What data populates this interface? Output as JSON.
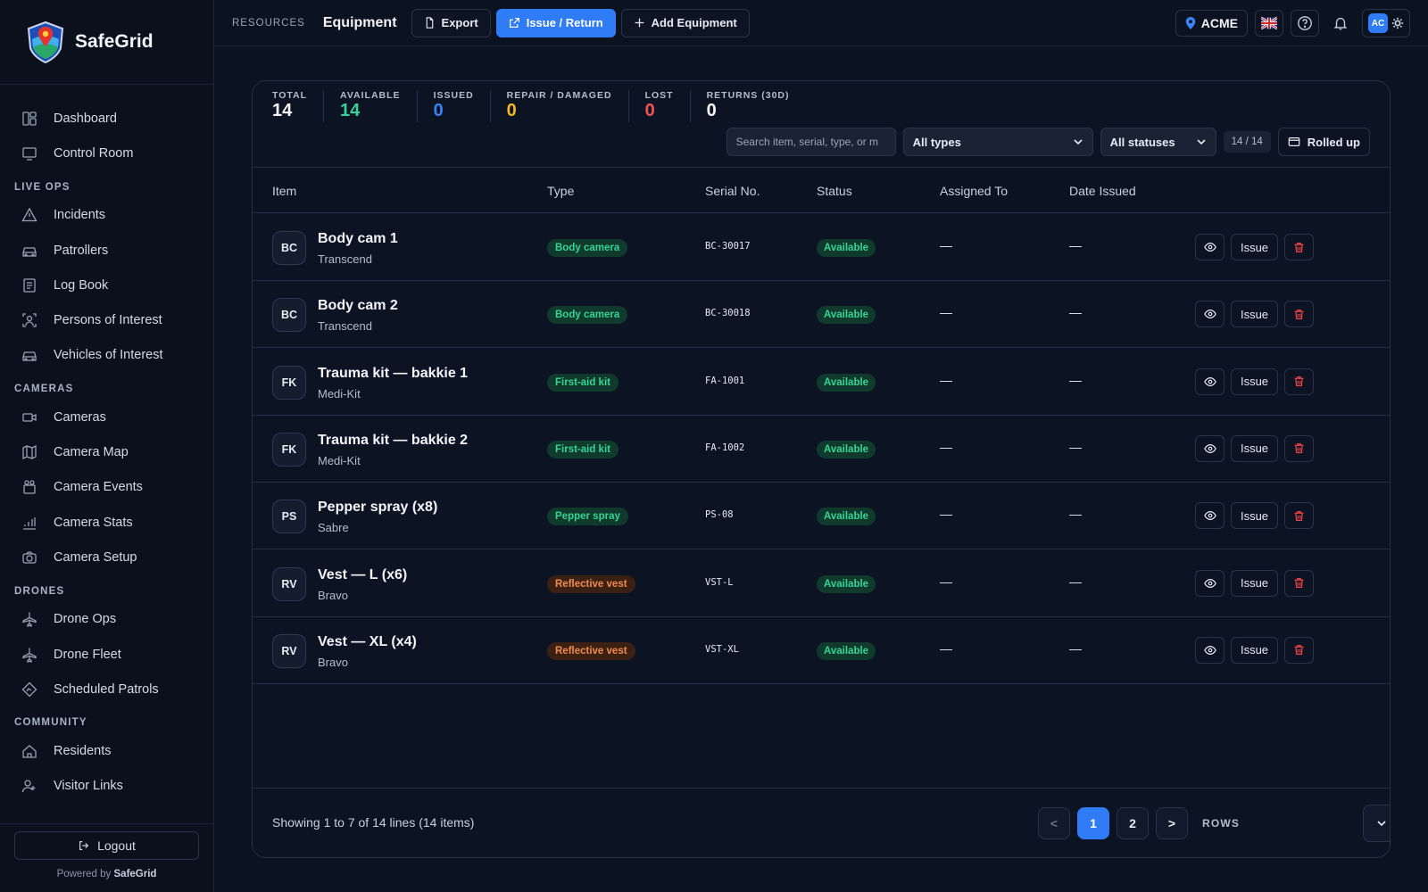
{
  "brand": {
    "name": "SafeGrid"
  },
  "nav": {
    "items_top": [
      {
        "label": "Dashboard",
        "icon": "dashboard-icon"
      },
      {
        "label": "Control Room",
        "icon": "monitor-icon"
      }
    ],
    "live_ops": {
      "title": "LIVE OPS",
      "items": [
        {
          "label": "Incidents",
          "icon": "warning-icon"
        },
        {
          "label": "Patrollers",
          "icon": "car-icon"
        },
        {
          "label": "Log Book",
          "icon": "logbook-icon"
        },
        {
          "label": "Persons of Interest",
          "icon": "person-scan-icon"
        },
        {
          "label": "Vehicles of Interest",
          "icon": "car-icon"
        }
      ]
    },
    "cameras": {
      "title": "CAMERAS",
      "items": [
        {
          "label": "Cameras",
          "icon": "camera-icon"
        },
        {
          "label": "Camera Map",
          "icon": "map-icon"
        },
        {
          "label": "Camera Events",
          "icon": "film-icon"
        },
        {
          "label": "Camera Stats",
          "icon": "bar-chart-icon"
        },
        {
          "label": "Camera Setup",
          "icon": "camera-setup-icon"
        }
      ]
    },
    "drones": {
      "title": "DRONES",
      "items": [
        {
          "label": "Drone Ops",
          "icon": "plane-icon"
        },
        {
          "label": "Drone Fleet",
          "icon": "plane-icon"
        },
        {
          "label": "Scheduled Patrols",
          "icon": "route-icon"
        }
      ]
    },
    "community": {
      "title": "COMMUNITY",
      "items": [
        {
          "label": "Residents",
          "icon": "home-icon"
        },
        {
          "label": "Visitor Links",
          "icon": "user-plus-icon"
        }
      ]
    },
    "logout": "Logout",
    "powered_prefix": "Powered by",
    "powered_brand": "SafeGrid"
  },
  "topbar": {
    "crumb": "RESOURCES",
    "title": "Equipment",
    "export": "Export",
    "issue_return": "Issue / Return",
    "add_equipment": "Add Equipment",
    "org": "ACME",
    "avatar": "AC"
  },
  "stats": [
    {
      "label": "TOTAL",
      "value": "14",
      "color": "#f2f5fa"
    },
    {
      "label": "AVAILABLE",
      "value": "14",
      "color": "#34d399"
    },
    {
      "label": "ISSUED",
      "value": "0",
      "color": "#3b82f6"
    },
    {
      "label": "REPAIR / DAMAGED",
      "value": "0",
      "color": "#f5b626"
    },
    {
      "label": "LOST",
      "value": "0",
      "color": "#f05252"
    },
    {
      "label": "RETURNS (30D)",
      "value": "0",
      "color": "#f2f5fa"
    }
  ],
  "filters": {
    "search_placeholder": "Search item, serial, type, or m",
    "type_select": "All types",
    "status_select": "All statuses",
    "count": "14 / 14",
    "rolled_up": "Rolled up"
  },
  "table": {
    "headers": [
      "Item",
      "Type",
      "Serial No.",
      "Status",
      "Assigned To",
      "Date Issued"
    ],
    "issue_label": "Issue",
    "rows": [
      {
        "abbr": "BC",
        "name": "Body cam 1",
        "brand": "Transcend",
        "type": "Body camera",
        "type_style": "green",
        "serial": "BC-30017",
        "status": "Available",
        "assigned": "—",
        "date": "—"
      },
      {
        "abbr": "BC",
        "name": "Body cam 2",
        "brand": "Transcend",
        "type": "Body camera",
        "type_style": "green",
        "serial": "BC-30018",
        "status": "Available",
        "assigned": "—",
        "date": "—"
      },
      {
        "abbr": "FK",
        "name": "Trauma kit — bakkie 1",
        "brand": "Medi-Kit",
        "type": "First-aid kit",
        "type_style": "green",
        "serial": "FA-1001",
        "status": "Available",
        "assigned": "—",
        "date": "—"
      },
      {
        "abbr": "FK",
        "name": "Trauma kit — bakkie 2",
        "brand": "Medi-Kit",
        "type": "First-aid kit",
        "type_style": "green",
        "serial": "FA-1002",
        "status": "Available",
        "assigned": "—",
        "date": "—"
      },
      {
        "abbr": "PS",
        "name": "Pepper spray (x8)",
        "brand": "Sabre",
        "type": "Pepper spray",
        "type_style": "green",
        "serial": "PS-08",
        "status": "Available",
        "assigned": "—",
        "date": "—"
      },
      {
        "abbr": "RV",
        "name": "Vest — L (x6)",
        "brand": "Bravo",
        "type": "Reflective vest",
        "type_style": "orange",
        "serial": "VST-L",
        "status": "Available",
        "assigned": "—",
        "date": "—"
      },
      {
        "abbr": "RV",
        "name": "Vest — XL (x4)",
        "brand": "Bravo",
        "type": "Reflective vest",
        "type_style": "orange",
        "serial": "VST-XL",
        "status": "Available",
        "assigned": "—",
        "date": "—"
      }
    ]
  },
  "footer": {
    "showing": "Showing 1 to 7 of 14 lines (14 items)",
    "prev": "<",
    "pages": [
      "1",
      "2"
    ],
    "next": ">",
    "rows_label": "ROWS"
  },
  "colors": {
    "accent": "#2f7cf6",
    "available_green": "#34d399",
    "orange_tag": "#f08a4b",
    "danger": "#ef4444"
  }
}
